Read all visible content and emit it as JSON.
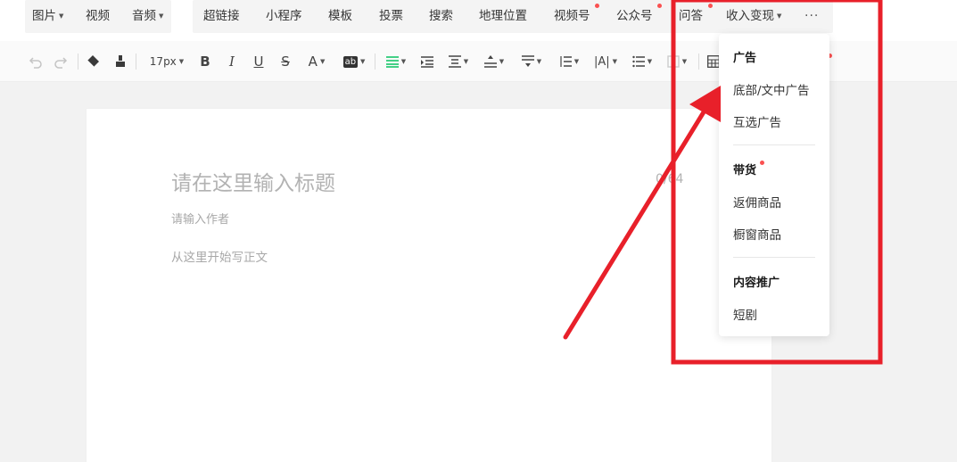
{
  "insert_bar": {
    "image": "图片",
    "video": "视频",
    "audio": "音频",
    "hyperlink": "超链接",
    "mini_program": "小程序",
    "template": "模板",
    "vote": "投票",
    "search": "搜索",
    "location": "地理位置",
    "channels": "视频号",
    "official_account": "公众号",
    "qa": "问答",
    "monetize": "收入变现",
    "more": "···"
  },
  "format_bar": {
    "font_size": "17px",
    "bold": "B",
    "italic": "I",
    "underline": "U",
    "strike": "S",
    "font_color": "A",
    "bg_color": "ab",
    "letter_spacing": "|A|"
  },
  "editor": {
    "title_placeholder": "请在这里输入标题",
    "title_count": "0/64",
    "author_placeholder": "请输入作者",
    "body_placeholder": "从这里开始写正文"
  },
  "monetize_menu": {
    "ads_header": "广告",
    "ads_bottom": "底部/文中广告",
    "ads_mutual": "互选广告",
    "goods_header": "带货",
    "goods_commission": "返佣商品",
    "goods_showcase": "橱窗商品",
    "promo_header": "内容推广",
    "promo_drama": "短剧"
  },
  "colors": {
    "annotation_red": "#e8202a",
    "notice_dot": "#fa5151",
    "align_active": "#07c160"
  }
}
